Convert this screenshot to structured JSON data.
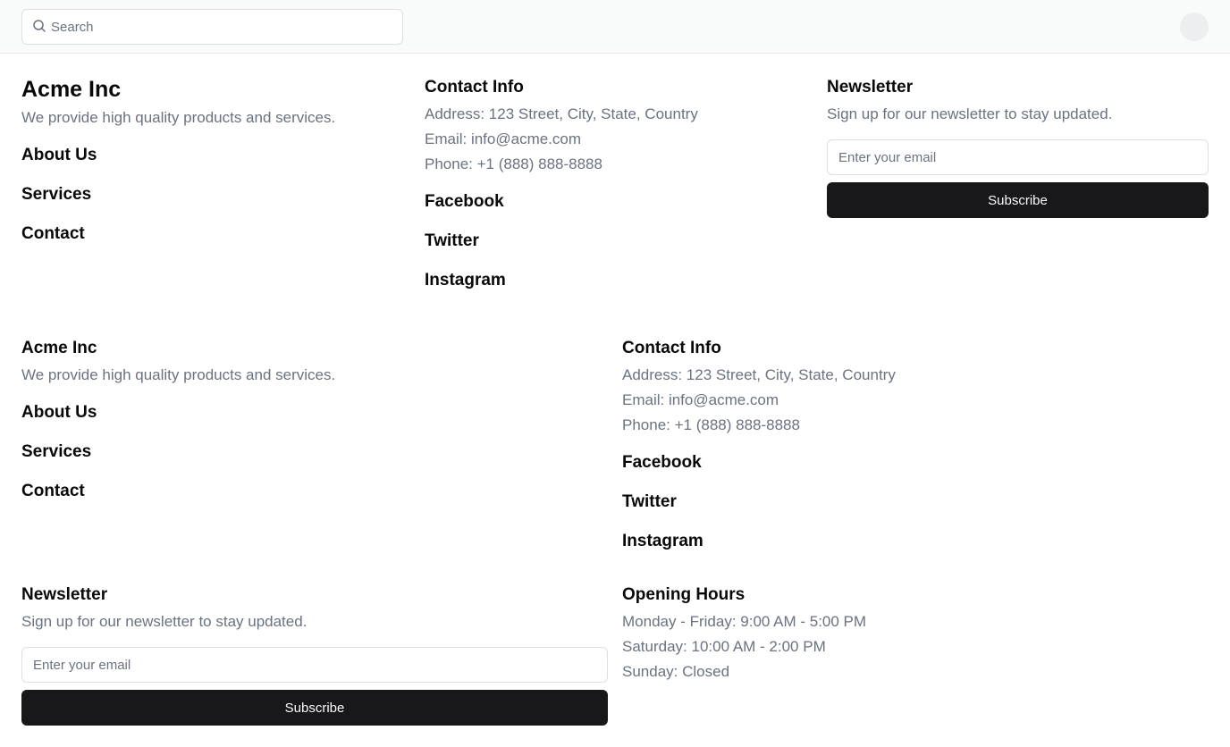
{
  "search": {
    "placeholder": "Search"
  },
  "footer_top": {
    "company": {
      "name": "Acme Inc",
      "tagline": "We provide high quality products and services.",
      "links": [
        "About Us",
        "Services",
        "Contact"
      ]
    },
    "contact": {
      "title": "Contact Info",
      "address": "Address: 123 Street, City, State, Country",
      "email": "Email: info@acme.com",
      "phone": "Phone: +1 (888) 888-8888",
      "social": [
        "Facebook",
        "Twitter",
        "Instagram"
      ]
    },
    "newsletter": {
      "title": "Newsletter",
      "description": "Sign up for our newsletter to stay updated.",
      "email_placeholder": "Enter your email",
      "button": "Subscribe"
    }
  },
  "footer_bottom": {
    "company": {
      "name": "Acme Inc",
      "tagline": "We provide high quality products and services.",
      "links": [
        "About Us",
        "Services",
        "Contact"
      ]
    },
    "contact": {
      "title": "Contact Info",
      "address": "Address: 123 Street, City, State, Country",
      "email": "Email: info@acme.com",
      "phone": "Phone: +1 (888) 888-8888",
      "social": [
        "Facebook",
        "Twitter",
        "Instagram"
      ]
    },
    "newsletter": {
      "title": "Newsletter",
      "description": "Sign up for our newsletter to stay updated.",
      "email_placeholder": "Enter your email",
      "button": "Subscribe"
    },
    "hours": {
      "title": "Opening Hours",
      "weekdays": "Monday - Friday: 9:00 AM - 5:00 PM",
      "saturday": "Saturday: 10:00 AM - 2:00 PM",
      "sunday": "Sunday: Closed"
    }
  }
}
